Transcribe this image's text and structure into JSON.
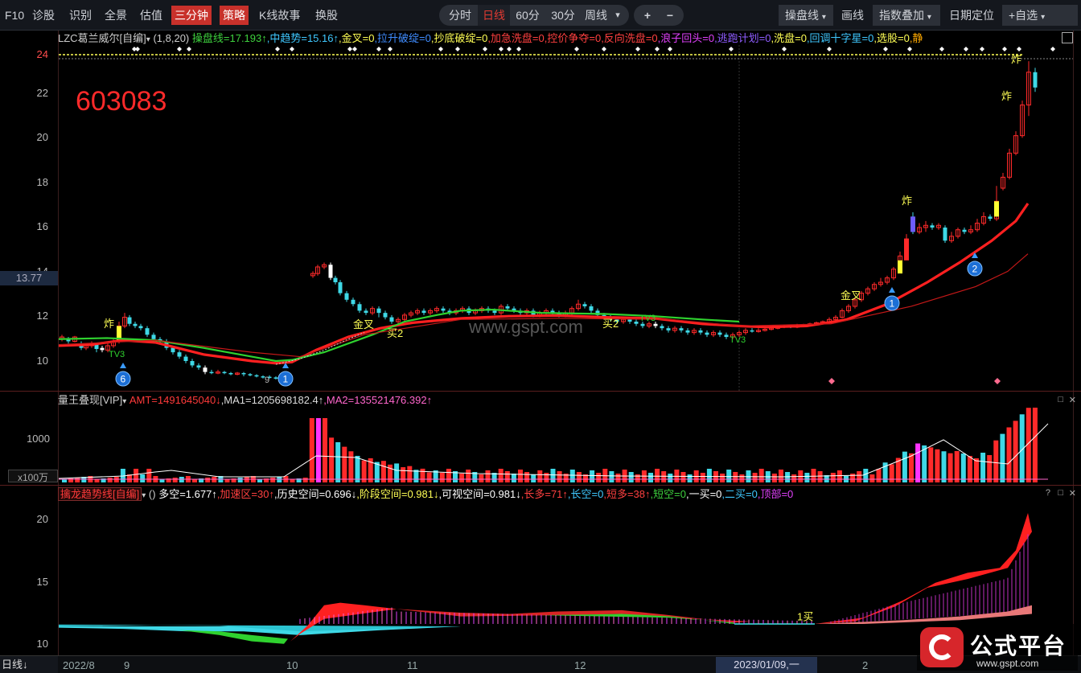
{
  "toolbar": {
    "f10": "F10",
    "items": [
      "诊股",
      "识别",
      "全景",
      "估值"
    ],
    "red1": "三分钟",
    "red2": "策略",
    "more": [
      "K线故事",
      "换股"
    ],
    "periods": [
      "分时",
      "日线",
      "60分",
      "30分",
      "周线"
    ],
    "period_arrow": "▾",
    "plus": "+",
    "minus": "−",
    "right_dd1": "操盘线",
    "right_btn1": "画线",
    "right_dd2": "指数叠加",
    "right_btn2": "日期定位",
    "right_dd3": "+自选",
    "arrow": "▾"
  },
  "main": {
    "indicator_name": "LZC葛兰威尔[自编]",
    "param": "(1,8,20)",
    "params_items": [
      {
        "text": "操盘线=17.193↑",
        "color": "#3ed23e"
      },
      {
        "text": ",中趋势=15.16↑",
        "color": "#3fc8ff"
      },
      {
        "text": ",金叉=0",
        "color": "#ffff55"
      },
      {
        "text": ",拉升破绽=0",
        "color": "#3f8cff"
      },
      {
        "text": ",抄底破绽=0",
        "color": "#ffff55"
      },
      {
        "text": ",加急洗盘=0",
        "color": "#ff4040"
      },
      {
        "text": ",控价争夺=0",
        "color": "#ff4040"
      },
      {
        "text": ",反向洗盘=0",
        "color": "#ff4040"
      },
      {
        "text": ",浪子回头=0",
        "color": "#e040fb"
      },
      {
        "text": ",逃跑计划=0",
        "color": "#8f5cff"
      },
      {
        "text": ",洗盘=0",
        "color": "#ffff55"
      },
      {
        "text": ",回调十字星=0",
        "color": "#3fc8ff"
      },
      {
        "text": ",选股=0",
        "color": "#ffff55"
      },
      {
        "text": ",静",
        "color": "#ffaa00"
      }
    ],
    "stock_code": "603083",
    "watermark": "www.gspt.com",
    "y_labels": [
      "24",
      "22",
      "20",
      "18",
      "16",
      "14",
      "12",
      "10"
    ],
    "current_price": "13.77",
    "tags": {
      "zha1": "炸",
      "zha2": "炸",
      "zha3": "炸",
      "zha4": "炸",
      "jincha1": "金叉",
      "jincha2": "金叉",
      "mai2a": "买2",
      "mai2b": "买2",
      "tv1": "TV3",
      "tv2": "TV3",
      "tv3": "TV3",
      "b1": "1",
      "b2": "2",
      "b6": "6",
      "b9": "1",
      "p9": "9"
    }
  },
  "vol": {
    "indicator_name": "量王叠现[VIP]",
    "amt": "AMT=1491645040↓",
    "ma1": ",MA1=1205698182.4↑",
    "ma2": ",MA2=135521476.392↑",
    "y_label": "1000",
    "unit": "x100万"
  },
  "trend": {
    "indicator_name": "擒龙趋势线[自编]",
    "paren": "()",
    "items": [
      {
        "text": "多空=1.677↑",
        "color": "#ffffff"
      },
      {
        "text": ",加速区=30↑",
        "color": "#ff4040"
      },
      {
        "text": ",历史空间=0.696↓",
        "color": "#ffffff"
      },
      {
        "text": ",阶段空间=0.981↓",
        "color": "#ffff55"
      },
      {
        "text": ",可视空间=0.981↓",
        "color": "#ffffff"
      },
      {
        "text": ",长多=71↑",
        "color": "#ff4040"
      },
      {
        "text": ",长空=0",
        "color": "#3fc8ff"
      },
      {
        "text": ",短多=38↑",
        "color": "#ff4040"
      },
      {
        "text": ",短空=0",
        "color": "#3ed23e"
      },
      {
        "text": ",一买=0",
        "color": "#ffffff"
      },
      {
        "text": ",二买=0",
        "color": "#3fc8ff"
      },
      {
        "text": ",顶部=0",
        "color": "#e040fb"
      }
    ],
    "y_labels": [
      "20",
      "15",
      "10"
    ],
    "buy_label": "1买",
    "help": "?"
  },
  "bottom": {
    "period": "日线",
    "arrow": "↓",
    "dates": [
      "2022/8",
      "9",
      "10",
      "11",
      "12",
      "2023/01/09,一",
      "2"
    ]
  },
  "logo": {
    "name": "公式平台",
    "url": "www.gspt.com"
  },
  "colors": {
    "up": "#ff2a2a",
    "down": "#3ed8e6",
    "ma_green": "#2fd22f",
    "ma_red": "#ff2020",
    "yellow": "#ffff55"
  }
}
